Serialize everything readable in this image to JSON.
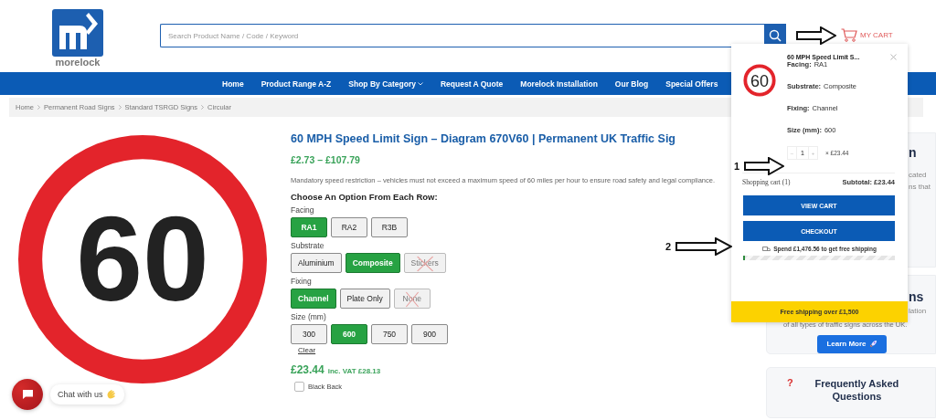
{
  "header": {
    "logo_text": "morelock",
    "search": {
      "placeholder": "Search Product Name / Code / Keyword"
    },
    "cart_label": "MY CART"
  },
  "nav": [
    {
      "label": "Home",
      "dropdown": false
    },
    {
      "label": "Product Range A-Z",
      "dropdown": false
    },
    {
      "label": "Shop By Category",
      "dropdown": true
    },
    {
      "label": "Request A Quote",
      "dropdown": false
    },
    {
      "label": "Morelock Installation",
      "dropdown": false
    },
    {
      "label": "Our Blog",
      "dropdown": false
    },
    {
      "label": "Special Offers",
      "dropdown": false
    }
  ],
  "breadcrumb": [
    "Home",
    "Permanent Road Signs",
    "Standard TSRGD Signs",
    "Circular"
  ],
  "product": {
    "image_text": "60",
    "title": "60 MPH Speed Limit Sign – Diagram 670V60 | Permanent UK Traffic Sig",
    "price_range": "£2.73 – £107.79",
    "description": "Mandatory speed restriction – vehicles must not exceed a maximum speed of 60 miles per hour to ensure road safety and legal compliance.",
    "options_heading": "Choose An Option From Each Row:",
    "option_groups": [
      {
        "label": "Facing",
        "options": [
          {
            "label": "RA1",
            "selected": true,
            "disabled": false
          },
          {
            "label": "RA2",
            "selected": false,
            "disabled": false
          },
          {
            "label": "R3B",
            "selected": false,
            "disabled": false
          }
        ]
      },
      {
        "label": "Substrate",
        "options": [
          {
            "label": "Aluminium",
            "selected": false,
            "disabled": false
          },
          {
            "label": "Composite",
            "selected": true,
            "disabled": false
          },
          {
            "label": "Stickers",
            "selected": false,
            "disabled": true
          }
        ]
      },
      {
        "label": "Fixing",
        "options": [
          {
            "label": "Channel",
            "selected": true,
            "disabled": false
          },
          {
            "label": "Plate Only",
            "selected": false,
            "disabled": false
          },
          {
            "label": "None",
            "selected": false,
            "disabled": true
          }
        ]
      },
      {
        "label": "Size (mm)",
        "options": [
          {
            "label": "300",
            "selected": false,
            "disabled": false
          },
          {
            "label": "600",
            "selected": true,
            "disabled": false
          },
          {
            "label": "750",
            "selected": false,
            "disabled": false
          },
          {
            "label": "900",
            "selected": false,
            "disabled": false
          }
        ]
      }
    ],
    "clear": "Clear",
    "price": "£23.44",
    "vat": "inc. VAT £28.13",
    "addons": [
      {
        "label": "Black Back",
        "checked": false
      }
    ]
  },
  "side_cards": [
    {
      "fragments": [
        "n",
        "cated",
        "ns that"
      ]
    },
    {
      "fragments": [
        "ns",
        "lation"
      ],
      "text": "of all types of traffic signs across the UK.",
      "button": "Learn More"
    },
    {
      "mark": "?",
      "title": "Frequently Asked Questions"
    }
  ],
  "cart_popup": {
    "item": {
      "image_text": "60",
      "name": "60 MPH Speed Limit S...",
      "attributes": [
        {
          "name": "Facing:",
          "value": "RA1"
        },
        {
          "name": "Substrate:",
          "value": "Composite"
        },
        {
          "name": "Fixing:",
          "value": "Channel"
        },
        {
          "name": "Size (mm):",
          "value": "600"
        }
      ],
      "minus": "–",
      "quantity": "1",
      "plus": "+",
      "line_price": "× £23.44"
    },
    "count_label": "Shopping cart (1)",
    "subtotal": "Subtotal: £23.44",
    "buttons": [
      "VIEW CART",
      "CHECKOUT"
    ],
    "shipping_note": "Spend **£1,476.56** to get free shipping",
    "level": 0.01,
    "banner": "Free shipping over £1,500"
  },
  "annotations": [
    {
      "kind": "arrow"
    },
    {
      "kind": "numbered",
      "number": "1"
    },
    {
      "kind": "numbered",
      "number": "2"
    }
  ],
  "chat": {
    "label": "Chat with us"
  }
}
